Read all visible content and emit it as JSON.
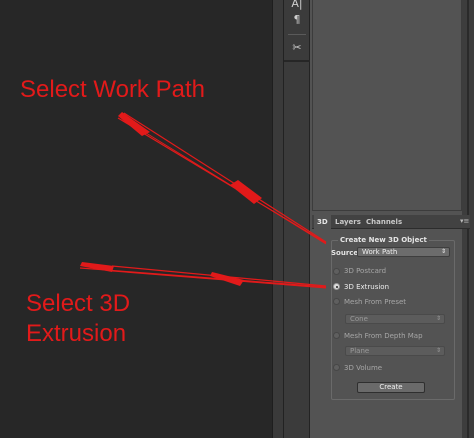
{
  "toolbar": {
    "items": [
      {
        "icon": "character-icon",
        "glyph": "A|"
      },
      {
        "icon": "paragraph-icon",
        "glyph": "¶"
      },
      {
        "icon": "tools-icon",
        "glyph": "✂"
      }
    ]
  },
  "panel": {
    "tabs": [
      "3D",
      "Layers",
      "Channels"
    ],
    "active_tab": "3D",
    "menu_glyph": "▾≡",
    "group_title": "Create New 3D Object",
    "source_label": "Source:",
    "source_value": "Work Path",
    "options": {
      "postcard": "3D Postcard",
      "extrusion": "3D Extrusion",
      "mesh_preset": "Mesh From Preset",
      "mesh_preset_value": "Cone",
      "mesh_depth": "Mesh From Depth Map",
      "mesh_depth_value": "Plane",
      "volume": "3D Volume"
    },
    "selected_option": "3D Extrusion",
    "create_label": "Create"
  },
  "annotations": {
    "work_path": "Select Work Path",
    "extrusion_line1": "Select 3D",
    "extrusion_line2": "Extrusion"
  },
  "colors": {
    "annotation": "#e21a1a",
    "panel_bg": "#535353",
    "canvas_bg": "#272727"
  }
}
